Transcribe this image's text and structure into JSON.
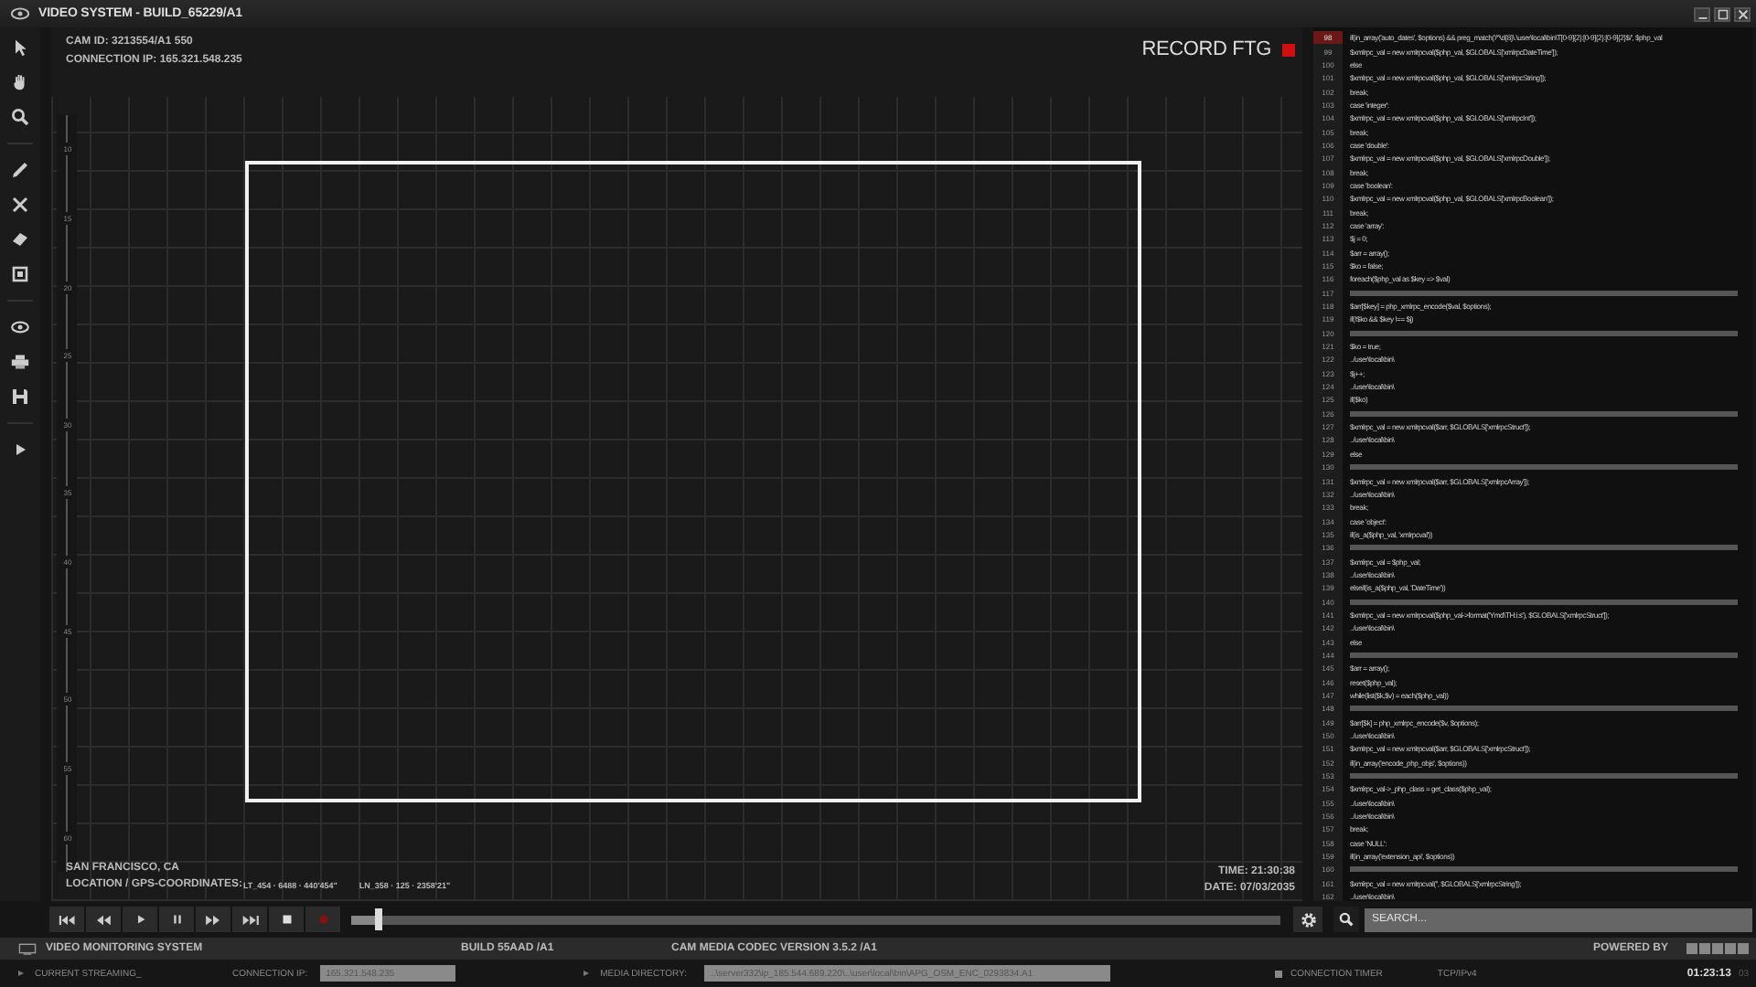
{
  "window": {
    "title": "VIDEO SYSTEM - BUILD_65229/A1"
  },
  "overlay": {
    "cam_id": "CAM ID: 3213554/A1 550",
    "connection_ip": "CONNECTION IP: 165.321.548.235",
    "record_label": "RECORD FTG",
    "recording": true,
    "location": "SAN FRANCISCO, CA",
    "coordinates_label": "LOCATION / GPS-COORDINATES:",
    "latitude": "LT_454 · 6488 · 440'454\"",
    "longitude": "LN_358 · 125 · 2358'21\"",
    "time": "TIME: 21:30:38",
    "date": "DATE: 07/03/2035"
  },
  "ruler": {
    "labels": [
      "10",
      "15",
      "20",
      "25",
      "30",
      "35",
      "40",
      "45",
      "50",
      "55",
      "60"
    ]
  },
  "code": {
    "lines": [
      {
        "number": "98",
        "kind": "code",
        "selected": true,
        "text": "if(in_array('auto_dates', $options) && preg_match('/^\\d{8}\\.\\user\\local\\bin\\T[0-9]{2}:[0-9]{2}:[0-9]{2}$/', $php_val"
      },
      {
        "number": "99",
        "kind": "code",
        "selected": false,
        "text": "$xmlrpc_val = new xmlrpcval($php_val, $GLOBALS['xmlrpcDateTime']);"
      },
      {
        "number": "100",
        "kind": "code",
        "selected": false,
        "text": "else"
      },
      {
        "number": "101",
        "kind": "code",
        "selected": false,
        "text": "$xmlrpc_val = new xmlrpcval($php_val, $GLOBALS['xmlrpcString']);"
      },
      {
        "number": "102",
        "kind": "code",
        "selected": false,
        "text": "break;"
      },
      {
        "number": "103",
        "kind": "code",
        "selected": false,
        "text": "case 'integer':"
      },
      {
        "number": "104",
        "kind": "code",
        "selected": false,
        "text": "$xmlrpc_val = new xmlrpcval($php_val, $GLOBALS['xmlrpcInt']);"
      },
      {
        "number": "105",
        "kind": "code",
        "selected": false,
        "text": "break;"
      },
      {
        "number": "106",
        "kind": "code",
        "selected": false,
        "text": "case 'double':"
      },
      {
        "number": "107",
        "kind": "code",
        "selected": false,
        "text": "$xmlrpc_val = new xmlrpcval($php_val, $GLOBALS['xmlrpcDouble']);"
      },
      {
        "number": "108",
        "kind": "code",
        "selected": false,
        "text": "break;"
      },
      {
        "number": "109",
        "kind": "code",
        "selected": false,
        "text": "case 'boolean':"
      },
      {
        "number": "110",
        "kind": "code",
        "selected": false,
        "text": "$xmlrpc_val = new xmlrpcval($php_val, $GLOBALS['xmlrpcBoolean']);"
      },
      {
        "number": "111",
        "kind": "code",
        "selected": false,
        "text": "break;"
      },
      {
        "number": "112",
        "kind": "code",
        "selected": false,
        "text": "case 'array':"
      },
      {
        "number": "113",
        "kind": "code",
        "selected": false,
        "text": "$j = 0;"
      },
      {
        "number": "114",
        "kind": "code",
        "selected": false,
        "text": "$arr = array();"
      },
      {
        "number": "115",
        "kind": "code",
        "selected": false,
        "text": "$ko = false;"
      },
      {
        "number": "116",
        "kind": "code",
        "selected": false,
        "text": "foreach($php_val as $key => $val)"
      },
      {
        "number": "117",
        "kind": "bar",
        "selected": false
      },
      {
        "number": "118",
        "kind": "code",
        "selected": false,
        "text": "$arr[$key] = php_xmlrpc_encode($val, $options);"
      },
      {
        "number": "119",
        "kind": "code",
        "selected": false,
        "text": "if(!$ko && $key !== $j)"
      },
      {
        "number": "120",
        "kind": "bar",
        "selected": false
      },
      {
        "number": "121",
        "kind": "code",
        "selected": false,
        "text": "$ko = true;"
      },
      {
        "number": "122",
        "kind": "code",
        "selected": false,
        "text": "../user\\local\\bin\\"
      },
      {
        "number": "123",
        "kind": "code",
        "selected": false,
        "text": "$j++;"
      },
      {
        "number": "124",
        "kind": "code",
        "selected": false,
        "text": "../user\\local\\bin\\"
      },
      {
        "number": "125",
        "kind": "code",
        "selected": false,
        "text": "if($ko)"
      },
      {
        "number": "126",
        "kind": "bar",
        "selected": false
      },
      {
        "number": "127",
        "kind": "code",
        "selected": false,
        "text": "$xmlrpc_val = new xmlrpcval($arr, $GLOBALS['xmlrpcStruct']);"
      },
      {
        "number": "128",
        "kind": "code",
        "selected": false,
        "text": "../user\\local\\bin\\"
      },
      {
        "number": "129",
        "kind": "code",
        "selected": false,
        "text": "else"
      },
      {
        "number": "130",
        "kind": "bar",
        "selected": false
      },
      {
        "number": "131",
        "kind": "code",
        "selected": false,
        "text": "$xmlrpc_val = new xmlrpcval($arr, $GLOBALS['xmlrpcArray']);"
      },
      {
        "number": "132",
        "kind": "code",
        "selected": false,
        "text": "../user\\local\\bin\\"
      },
      {
        "number": "133",
        "kind": "code",
        "selected": false,
        "text": "break;"
      },
      {
        "number": "134",
        "kind": "code",
        "selected": false,
        "text": "case 'object':"
      },
      {
        "number": "135",
        "kind": "code",
        "selected": false,
        "text": "if(is_a($php_val, 'xmlrpcval'))"
      },
      {
        "number": "136",
        "kind": "bar",
        "selected": false
      },
      {
        "number": "137",
        "kind": "code",
        "selected": false,
        "text": "$xmlrpc_val = $php_val;"
      },
      {
        "number": "138",
        "kind": "code",
        "selected": false,
        "text": "../user\\local\\bin\\"
      },
      {
        "number": "139",
        "kind": "code",
        "selected": false,
        "text": "elseif(is_a($php_val, 'DateTime'))"
      },
      {
        "number": "140",
        "kind": "bar",
        "selected": false
      },
      {
        "number": "141",
        "kind": "code",
        "selected": false,
        "text": "$xmlrpc_val = new xmlrpcval($php_val->format('Ymd\\TH:i:s'), $GLOBALS['xmlrpcStruct']);"
      },
      {
        "number": "142",
        "kind": "code",
        "selected": false,
        "text": "../user\\local\\bin\\"
      },
      {
        "number": "143",
        "kind": "code",
        "selected": false,
        "text": "else"
      },
      {
        "number": "144",
        "kind": "bar",
        "selected": false
      },
      {
        "number": "145",
        "kind": "code",
        "selected": false,
        "text": "$arr = array();"
      },
      {
        "number": "146",
        "kind": "code",
        "selected": false,
        "text": "reset($php_val);"
      },
      {
        "number": "147",
        "kind": "code",
        "selected": false,
        "text": "while(list($k,$v) = each($php_val))"
      },
      {
        "number": "148",
        "kind": "bar",
        "selected": false
      },
      {
        "number": "149",
        "kind": "code",
        "selected": false,
        "text": "$arr[$k] = php_xmlrpc_encode($v, $options);"
      },
      {
        "number": "150",
        "kind": "code",
        "selected": false,
        "text": "../user\\local\\bin\\"
      },
      {
        "number": "151",
        "kind": "code",
        "selected": false,
        "text": "$xmlrpc_val = new xmlrpcval($arr, $GLOBALS['xmlrpcStruct']);"
      },
      {
        "number": "152",
        "kind": "code",
        "selected": false,
        "text": "if(in_array('encode_php_objs', $options))"
      },
      {
        "number": "153",
        "kind": "bar",
        "selected": false
      },
      {
        "number": "154",
        "kind": "code",
        "selected": false,
        "text": "$xmlrpc_val->_php_class = get_class($php_val);"
      },
      {
        "number": "155",
        "kind": "code",
        "selected": false,
        "text": "../user\\local\\bin\\"
      },
      {
        "number": "156",
        "kind": "code",
        "selected": false,
        "text": "../user\\local\\bin\\"
      },
      {
        "number": "157",
        "kind": "code",
        "selected": false,
        "text": "break;"
      },
      {
        "number": "158",
        "kind": "code",
        "selected": false,
        "text": "case 'NULL':"
      },
      {
        "number": "159",
        "kind": "code",
        "selected": false,
        "text": "if(in_array('extension_api', $options))"
      },
      {
        "number": "160",
        "kind": "bar",
        "selected": false
      },
      {
        "number": "161",
        "kind": "code",
        "selected": false,
        "text": "$xmlrpc_val = new xmlrpcval('', $GLOBALS['xmlrpcString']);"
      },
      {
        "number": "162",
        "kind": "code",
        "selected": false,
        "text": "../user\\local\\bin\\"
      }
    ]
  },
  "player": {
    "seek": {
      "level": 0.03
    },
    "search": {
      "placeholder": "SEARCH..."
    }
  },
  "status_bar": {
    "app_name": "VIDEO MONITORING SYSTEM",
    "build": "BUILD 55AAD /A1",
    "codec": "CAM MEDIA CODEC VERSION 3.5.2 /A1",
    "powered_by": "POWERED BY"
  },
  "info_bar": {
    "streaming": "CURRENT STREAMING_",
    "connection_label": "CONNECTION IP:",
    "connection_value": "165.321.548.235",
    "directory_label": "MEDIA DIRECTORY:",
    "directory_value": "..\\server332\\ip_185.544.689.220\\..\\user\\local\\bin\\APG_OSM_ENC_0293834.A1",
    "timer_label": "CONNECTION TIMER",
    "protocol": "TCP/IPv4",
    "timer": "01:23:13",
    "timer_suffix": "03"
  }
}
